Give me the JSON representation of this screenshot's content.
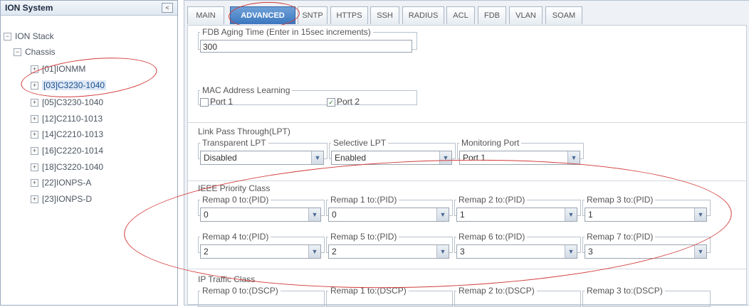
{
  "tree": {
    "title": "ION System",
    "collapse_glyph": "<",
    "root": {
      "label": "ION Stack",
      "toggle": "−"
    },
    "chassis": {
      "label": "Chassis",
      "toggle": "−"
    },
    "items": [
      {
        "label": "[01]IONMM",
        "toggle": "+"
      },
      {
        "label": "[03]C3230-1040",
        "toggle": "+"
      },
      {
        "label": "[05]C3230-1040",
        "toggle": "+"
      },
      {
        "label": "[12]C2110-1013",
        "toggle": "+"
      },
      {
        "label": "[14]C2210-1013",
        "toggle": "+"
      },
      {
        "label": "[16]C2220-1014",
        "toggle": "+"
      },
      {
        "label": "[18]C3220-1040",
        "toggle": "+"
      },
      {
        "label": "[22]IONPS-A",
        "toggle": "+"
      },
      {
        "label": "[23]IONPS-D",
        "toggle": "+"
      }
    ]
  },
  "tabs": [
    "MAIN",
    "ADVANCED",
    "SNTP",
    "HTTPS",
    "SSH",
    "RADIUS",
    "ACL",
    "FDB",
    "VLAN",
    "SOAM"
  ],
  "active_tab": "ADVANCED",
  "fdb": {
    "legend": "FDB Aging Time (Enter in 15sec increments)",
    "value": "300"
  },
  "mac": {
    "legend": "MAC Address Learning",
    "port1": "Port 1",
    "port2": "Port 2",
    "port1_checked": false,
    "port2_checked": true,
    "check_glyph": "✓"
  },
  "lpt": {
    "label": "Link Pass Through(LPT)",
    "transparent": {
      "legend": "Transparent LPT",
      "value": "Disabled"
    },
    "selective": {
      "legend": "Selective LPT",
      "value": "Enabled"
    },
    "monitoring": {
      "legend": "Monitoring Port",
      "value": "Port 1"
    }
  },
  "ieee": {
    "label": "IEEE Priority Class",
    "remaps": [
      {
        "legend": "Remap 0 to:(PID)",
        "value": "0"
      },
      {
        "legend": "Remap 1 to:(PID)",
        "value": "0"
      },
      {
        "legend": "Remap 2 to:(PID)",
        "value": "1"
      },
      {
        "legend": "Remap 3 to:(PID)",
        "value": "1"
      },
      {
        "legend": "Remap 4 to:(PID)",
        "value": "2"
      },
      {
        "legend": "Remap 5 to:(PID)",
        "value": "2"
      },
      {
        "legend": "Remap 6 to:(PID)",
        "value": "3"
      },
      {
        "legend": "Remap 7 to:(PID)",
        "value": "3"
      }
    ]
  },
  "ip_traffic": {
    "label": "IP Traffic Class",
    "remaps": [
      "Remap 0 to:(DSCP)",
      "Remap 1 to:(DSCP)",
      "Remap 2 to:(DSCP)",
      "Remap 3 to:(DSCP)"
    ]
  },
  "colors": {
    "accent": "#3b77bf",
    "annotation": "#d23a3a"
  },
  "dropdown_icon": "▼"
}
